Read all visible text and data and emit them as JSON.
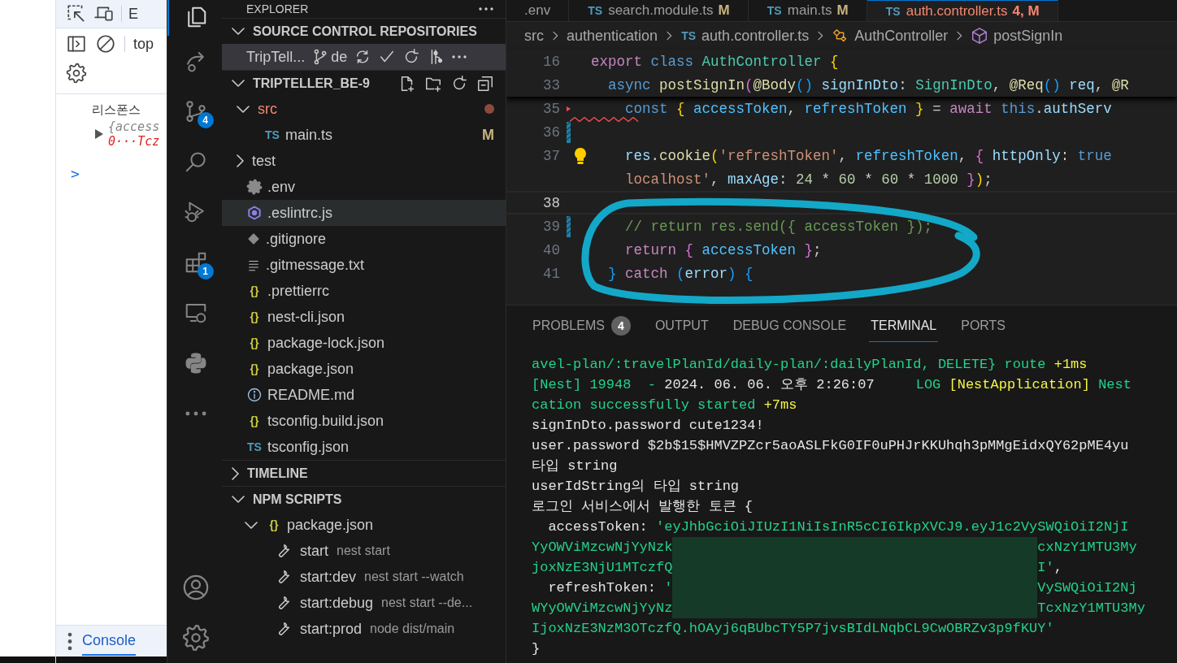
{
  "devtools": {
    "panel_tab": "E",
    "context": "top",
    "log_label": "리스폰스",
    "log_preview": "{access",
    "log_value": "0···Tcz",
    "expanded": false,
    "prompt": ">",
    "drawer_tab": {
      "label": "Console",
      "selected": true
    }
  },
  "activity_bar": [
    {
      "kind": "explorer",
      "selected": true
    },
    {
      "kind": "share",
      "selected": false
    },
    {
      "kind": "source-control",
      "selected": false,
      "badge": "4"
    },
    {
      "kind": "search",
      "selected": false
    },
    {
      "kind": "run-debug",
      "selected": false
    },
    {
      "kind": "extensions",
      "selected": false,
      "badge": "1"
    },
    {
      "kind": "remote",
      "selected": false
    },
    {
      "kind": "python",
      "selected": false
    },
    {
      "kind": "more",
      "selected": false
    },
    {
      "kind": "account",
      "selected": false
    },
    {
      "kind": "settings",
      "selected": false
    }
  ],
  "sidebar": {
    "title": "EXPLORER",
    "source_control": {
      "title": "SOURCE CONTROL REPOSITORIES",
      "expanded": true,
      "repo": {
        "name": "TripTell...",
        "branch": "de",
        "selected": true
      }
    },
    "folder": {
      "title": "TRIPTELLER_BE-9",
      "expanded": true,
      "items": [
        {
          "name": "src",
          "kind": "folder",
          "expanded": true,
          "modified": true,
          "selected": false,
          "children": [
            {
              "name": "main.ts",
              "kind": "ts",
              "glyph": "TS",
              "status": "M",
              "selected": false
            }
          ]
        },
        {
          "name": "test",
          "kind": "folder",
          "expanded": false,
          "modified": false,
          "selected": false
        },
        {
          "name": ".env",
          "kind": "gear",
          "selected": false
        },
        {
          "name": ".eslintrc.js",
          "kind": "eslint",
          "selected": true
        },
        {
          "name": ".gitignore",
          "kind": "git",
          "selected": false
        },
        {
          "name": ".gitmessage.txt",
          "kind": "text",
          "selected": false
        },
        {
          "name": ".prettierrc",
          "kind": "json",
          "glyph": "{}",
          "selected": false
        },
        {
          "name": "nest-cli.json",
          "kind": "json",
          "glyph": "{}",
          "selected": false
        },
        {
          "name": "package-lock.json",
          "kind": "json",
          "glyph": "{}",
          "selected": false
        },
        {
          "name": "package.json",
          "kind": "json",
          "glyph": "{}",
          "selected": false
        },
        {
          "name": "README.md",
          "kind": "info",
          "selected": false
        },
        {
          "name": "tsconfig.build.json",
          "kind": "json",
          "glyph": "{}",
          "selected": false
        },
        {
          "name": "tsconfig.json",
          "kind": "ts",
          "glyph": "TS",
          "selected": false
        }
      ]
    },
    "timeline": {
      "title": "TIMELINE",
      "expanded": false
    },
    "npm_scripts": {
      "title": "NPM SCRIPTS",
      "expanded": true,
      "package": {
        "name": "package.json",
        "glyph": "{}",
        "expanded": true
      },
      "scripts": [
        {
          "name": "start",
          "command": "nest start"
        },
        {
          "name": "start:dev",
          "command": "nest start --watch"
        },
        {
          "name": "start:debug",
          "command": "nest start --de..."
        },
        {
          "name": "start:prod",
          "command": "node dist/main"
        }
      ]
    }
  },
  "editor": {
    "tabs": [
      {
        "label": ".env",
        "selected": false
      },
      {
        "glyph": "TS",
        "label": "search.module.ts",
        "status": "M",
        "selected": false
      },
      {
        "glyph": "TS",
        "label": "main.ts",
        "status": "M",
        "selected": false
      },
      {
        "glyph": "TS",
        "label": "auth.controller.ts",
        "status": "4, M",
        "selected": true
      }
    ],
    "breadcrumb": [
      {
        "text": "src"
      },
      {
        "text": "authentication"
      },
      {
        "glyph": "TS",
        "text": "auth.controller.ts"
      },
      {
        "kind": "class",
        "text": "AuthController"
      },
      {
        "kind": "method",
        "text": "postSignIn"
      }
    ],
    "sticky_lines": [
      {
        "number": "16",
        "tokens": [
          {
            "text": "export",
            "kind": "control"
          },
          {
            "text": " class",
            "kind": "storage"
          },
          {
            "text": " AuthController",
            "kind": "type"
          },
          {
            "text": " {",
            "kind": "brace1"
          }
        ]
      },
      {
        "number": "33",
        "tokens": [
          {
            "text": "  async",
            "kind": "storage"
          },
          {
            "text": " postSignIn",
            "kind": "fn"
          },
          {
            "text": "(",
            "kind": "brace2"
          },
          {
            "text": "@Body",
            "kind": "fn"
          },
          {
            "text": "()",
            "kind": "brace3"
          },
          {
            "text": " signInDto",
            "kind": "var"
          },
          {
            "text": ": ",
            "kind": "plain"
          },
          {
            "text": "SignInDto",
            "kind": "type"
          },
          {
            "text": ", ",
            "kind": "plain"
          },
          {
            "text": "@Req",
            "kind": "fn"
          },
          {
            "text": "()",
            "kind": "brace3"
          },
          {
            "text": " req",
            "kind": "var"
          },
          {
            "text": ", ",
            "kind": "plain"
          },
          {
            "text": "@R",
            "kind": "fn"
          }
        ]
      }
    ],
    "lines": [
      {
        "number": "35",
        "deleted": true,
        "tokens": [
          {
            "text": "    const",
            "kind": "storage"
          },
          {
            "text": " {",
            "kind": "brace1"
          },
          {
            "text": " accessToken",
            "kind": "const"
          },
          {
            "text": ", ",
            "kind": "plain"
          },
          {
            "text": "refreshToken",
            "kind": "const"
          },
          {
            "text": " }",
            "kind": "brace1"
          },
          {
            "text": " = ",
            "kind": "plain"
          },
          {
            "text": "await",
            "kind": "control"
          },
          {
            "text": " this",
            "kind": "storage"
          },
          {
            "text": ".",
            "kind": "plain"
          },
          {
            "text": "authServ",
            "kind": "var"
          }
        ]
      },
      {
        "number": "36",
        "modified": true,
        "error": true
      },
      {
        "number": "37",
        "lightbulb": true,
        "tokens": [
          {
            "text": "    res",
            "kind": "var"
          },
          {
            "text": ".",
            "kind": "plain"
          },
          {
            "text": "cookie",
            "kind": "fn"
          },
          {
            "text": "(",
            "kind": "brace1"
          },
          {
            "text": "'refreshToken'",
            "kind": "string"
          },
          {
            "text": ", ",
            "kind": "plain"
          },
          {
            "text": "refreshToken",
            "kind": "const"
          },
          {
            "text": ", ",
            "kind": "plain"
          },
          {
            "text": "{",
            "kind": "brace2"
          },
          {
            "text": " httpOnly",
            "kind": "var"
          },
          {
            "text": ": ",
            "kind": "plain"
          },
          {
            "text": "true",
            "kind": "storage"
          }
        ]
      },
      {
        "tokens": [
          {
            "text": "    localhost'",
            "kind": "string"
          },
          {
            "text": ", ",
            "kind": "plain"
          },
          {
            "text": "maxAge",
            "kind": "var"
          },
          {
            "text": ": ",
            "kind": "plain"
          },
          {
            "text": "24",
            "kind": "number"
          },
          {
            "text": " * ",
            "kind": "plain"
          },
          {
            "text": "60",
            "kind": "number"
          },
          {
            "text": " * ",
            "kind": "plain"
          },
          {
            "text": "60",
            "kind": "number"
          },
          {
            "text": " * ",
            "kind": "plain"
          },
          {
            "text": "1000",
            "kind": "number"
          },
          {
            "text": " }",
            "kind": "brace2"
          },
          {
            "text": ")",
            "kind": "brace1"
          },
          {
            "text": ";",
            "kind": "plain"
          }
        ]
      },
      {
        "number": "38",
        "current": true
      },
      {
        "number": "39",
        "modified": true,
        "tokens": [
          {
            "text": "    // return res.send({ accessToken });",
            "kind": "comment"
          }
        ]
      },
      {
        "number": "40",
        "tokens": [
          {
            "text": "    return",
            "kind": "control"
          },
          {
            "text": " {",
            "kind": "brace2"
          },
          {
            "text": " accessToken",
            "kind": "const"
          },
          {
            "text": " }",
            "kind": "brace2"
          },
          {
            "text": ";",
            "kind": "plain"
          }
        ]
      },
      {
        "number": "41",
        "tokens": [
          {
            "text": "  }",
            "kind": "brace3"
          },
          {
            "text": " catch",
            "kind": "control"
          },
          {
            "text": " (",
            "kind": "brace3"
          },
          {
            "text": "error",
            "kind": "var"
          },
          {
            "text": ")",
            "kind": "brace3"
          },
          {
            "text": " {",
            "kind": "brace3"
          }
        ]
      }
    ]
  },
  "panel": {
    "tabs": [
      {
        "label": "PROBLEMS",
        "badge": "4",
        "selected": false
      },
      {
        "label": "OUTPUT",
        "selected": false
      },
      {
        "label": "DEBUG CONSOLE",
        "selected": false
      },
      {
        "label": "TERMINAL",
        "selected": true
      },
      {
        "label": "PORTS",
        "selected": false
      }
    ],
    "terminal": [
      {
        "kind": "text",
        "segments": [
          {
            "text": "avel-plan/:travelPlanId/daily-plan/:dailyPlanId, DELETE} route ",
            "kind": "log"
          },
          {
            "text": "+1ms",
            "kind": "highlight"
          }
        ]
      },
      {
        "kind": "text",
        "segments": [
          {
            "text": "[Nest] 19948  - ",
            "kind": "log"
          },
          {
            "text": "2024. 06. 06. 오후 2:26:07",
            "kind": "plain"
          },
          {
            "text": "     LOG ",
            "kind": "log"
          },
          {
            "text": "[NestApplication]",
            "kind": "highlight"
          },
          {
            "text": " Nest",
            "kind": "log"
          }
        ]
      },
      {
        "kind": "text",
        "segments": [
          {
            "text": "cation successfully started ",
            "kind": "log"
          },
          {
            "text": "+7ms",
            "kind": "highlight"
          }
        ]
      },
      {
        "kind": "text",
        "segments": [
          {
            "text": "signInDto.password cute1234!",
            "kind": "plain"
          }
        ]
      },
      {
        "kind": "text",
        "segments": [
          {
            "text": "user.password $2b$15$HMVZPZcr5aoASLFkG0IF0uPHJrKKUhqh3pMMgEidxQY62pME4yu",
            "kind": "plain"
          }
        ]
      },
      {
        "kind": "text",
        "segments": [
          {
            "text": "타입 string",
            "kind": "plain"
          }
        ]
      },
      {
        "kind": "text",
        "segments": [
          {
            "text": "userIdString의 타입 string",
            "kind": "plain"
          }
        ]
      },
      {
        "kind": "text",
        "segments": [
          {
            "text": "로그인 서비스에서 발행한 토큰 {",
            "kind": "plain"
          }
        ]
      },
      {
        "kind": "text",
        "segments": [
          {
            "text": "  accessToken: ",
            "kind": "plain"
          },
          {
            "text": "'eyJhbGciOiJIUzI1NiIsInR5cCI6IkpXVCJ9.eyJ1c2VySWQiOiI2NjI",
            "kind": "log"
          }
        ]
      },
      {
        "kind": "redacted",
        "rows": [
          {
            "left": [
              {
                "text": "YyOWViMzcwNjYyNzk",
                "kind": "log"
              }
            ],
            "right": [
              {
                "text": "cxNzY1MTU3My",
                "kind": "log"
              }
            ]
          },
          {
            "left": [
              {
                "text": "joxNzE3NjU1MTczfQ",
                "kind": "log"
              }
            ],
            "right": [
              {
                "text": "I'",
                "kind": "log"
              },
              {
                "text": ",",
                "kind": "plain"
              }
            ]
          },
          {
            "left": [
              {
                "text": "  refreshToken: ",
                "kind": "plain"
              },
              {
                "text": "'",
                "kind": "log"
              }
            ],
            "right": [
              {
                "text": "VySWQiOiI2Nj",
                "kind": "log"
              }
            ]
          },
          {
            "left": [
              {
                "text": "WYyOWViMzcwNjYyNz",
                "kind": "log"
              }
            ],
            "right": [
              {
                "text": "TcxNzY1MTU3My",
                "kind": "log"
              }
            ]
          }
        ]
      },
      {
        "kind": "text",
        "segments": [
          {
            "text": "IjoxNzE3NzM3OTczfQ.hOAyj6qBUbcTY5P7jvsBIdLNqbCL9CwOBRZv3p9fKUY'",
            "kind": "log"
          }
        ]
      },
      {
        "kind": "text",
        "segments": [
          {
            "text": "}",
            "kind": "plain"
          }
        ]
      }
    ]
  },
  "annotation": {
    "kind": "ellipse",
    "color": "#13a8c8"
  }
}
